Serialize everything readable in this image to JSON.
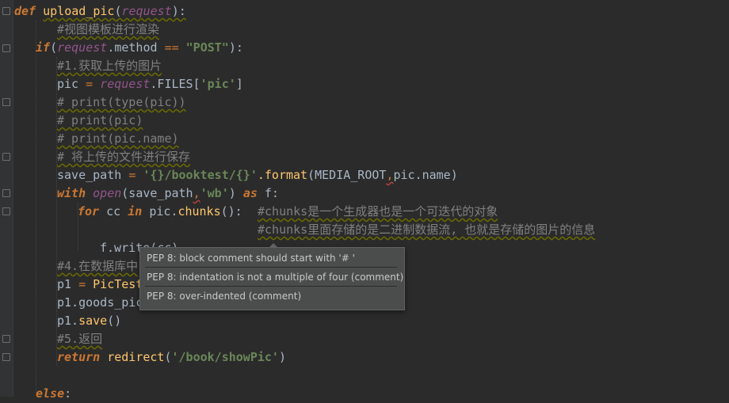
{
  "editor": {
    "lines": {
      "l1": {
        "kw": "def",
        "name": "upload_pic",
        "open": "(",
        "param": "request",
        "close": "):"
      },
      "l2": {
        "comment": "#视图模板进行渲染"
      },
      "l3": {
        "kw": "if",
        "open": "(",
        "self": "request",
        "attr": ".method ",
        "op": "==",
        "str": "\"POST\"",
        "close": "):"
      },
      "l4": {
        "comment": "#1.获取上传的图片"
      },
      "l5": {
        "var": "pic ",
        "op": "=",
        "self": "request",
        "attr": ".FILES[",
        "str": "'pic'",
        "close": "]"
      },
      "l6": {
        "comment": "# print(type(pic))"
      },
      "l7": {
        "comment": "# print(pic)"
      },
      "l8": {
        "comment": "# print(pic.name)"
      },
      "l9": {
        "comment": "# 将上传的文件进行保存"
      },
      "l10": {
        "var": "save_path ",
        "op": "=",
        "str": "'{}/booktest/{}'",
        "mth": ".format",
        "args": "(MEDIA_ROOT",
        "comma": ",",
        "args2": "pic.name)"
      },
      "l11": {
        "kw": "with",
        "fn": "open",
        "args": "(save_path",
        "comma": ",",
        "str": "'wb'",
        "close": ")",
        "kw2": "as",
        "rest": "f:"
      },
      "l12": {
        "kw": "for",
        "var": "cc",
        "kw2": "in",
        "rest": "pic.",
        "mth": "chunks",
        "close": "():",
        "comment": "#chunks是一个生成器也是一个可迭代的对象"
      },
      "l13": {
        "comment": "#chunks里面存储的是二进制数据流, 也就是存储的图片的信息"
      },
      "l14": {
        "code": "f.write(cc)"
      },
      "l15": {
        "comment": "#4.在数据库中"
      },
      "l16": {
        "var": "p1 ",
        "op": "=",
        "cls": "PicTest"
      },
      "l17": {
        "code": "p1.goods_pic"
      },
      "l18": {
        "code": "p1.",
        "mth": "save",
        "close": "()"
      },
      "l19": {
        "comment": "#5.返回"
      },
      "l20": {
        "kw": "return",
        "fn": "redirect",
        "open": "(",
        "str": "'/book/showPic'",
        "close": ")"
      },
      "l21": {
        "kw": "else",
        "close": ":"
      }
    }
  },
  "tooltip": {
    "items": [
      "PEP 8: block comment should start with '# '",
      "PEP 8: indentation is not a multiple of four (comment)",
      "PEP 8: over-indented (comment)"
    ]
  },
  "colors": {
    "background": "#2b2b2b",
    "keyword": "#cc7832",
    "function": "#ffc66d",
    "string": "#6a8759",
    "comment": "#808080",
    "self": "#94558d"
  }
}
